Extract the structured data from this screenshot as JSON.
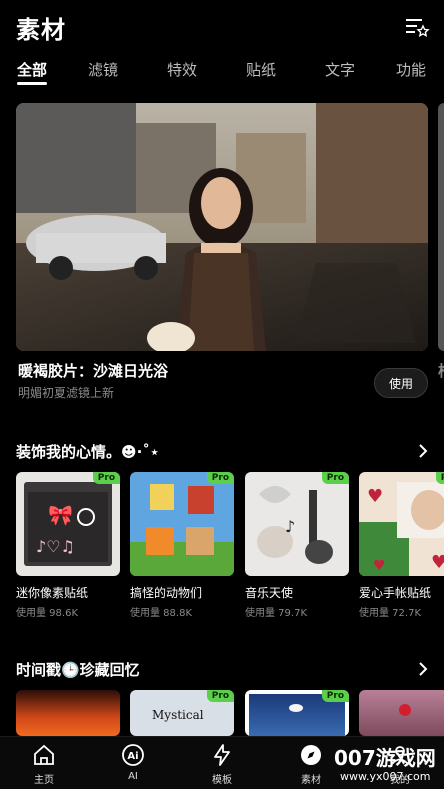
{
  "header": {
    "title": "素材"
  },
  "tabs": [
    {
      "label": "全部",
      "active": true
    },
    {
      "label": "滤镜"
    },
    {
      "label": "特效"
    },
    {
      "label": "贴纸"
    },
    {
      "label": "文字"
    },
    {
      "label": "功能"
    }
  ],
  "banner": {
    "title": "暖褐胶片：沙滩日光浴",
    "subtitle": "明媚初夏滤镜上新",
    "use_label": "使用",
    "next_peek_text": "柠"
  },
  "section1": {
    "title": "装饰我的心情。☻·˚⋆",
    "cards": [
      {
        "name": "迷你像素贴纸",
        "usage": "使用量 98.6K",
        "pro": "Pro"
      },
      {
        "name": "搞怪的动物们",
        "usage": "使用量 88.8K",
        "pro": "Pro"
      },
      {
        "name": "音乐天使",
        "usage": "使用量 79.7K",
        "pro": "Pro"
      },
      {
        "name": "爱心手帐贴纸",
        "usage": "使用量 72.7K",
        "pro": "Pro"
      }
    ]
  },
  "section2": {
    "title": "时间戳🕒珍藏回忆",
    "cards": [
      {
        "text": ""
      },
      {
        "text": "Mystical",
        "pro": "Pro"
      },
      {
        "text": "",
        "pro": "Pro"
      },
      {
        "text": ""
      }
    ]
  },
  "nav": [
    {
      "label": "主页",
      "icon": "home-icon"
    },
    {
      "label": "AI",
      "icon": "ai-icon"
    },
    {
      "label": "模板",
      "icon": "lightning-icon"
    },
    {
      "label": "素材",
      "icon": "compass-icon"
    },
    {
      "label": "我的",
      "icon": "profile-icon"
    }
  ],
  "watermark": {
    "text": "007游戏网",
    "url": "www.yx007.com"
  },
  "colors": {
    "pro_badge": "#5ccf4a",
    "background": "#000000",
    "muted_text": "#8a8a8a"
  }
}
